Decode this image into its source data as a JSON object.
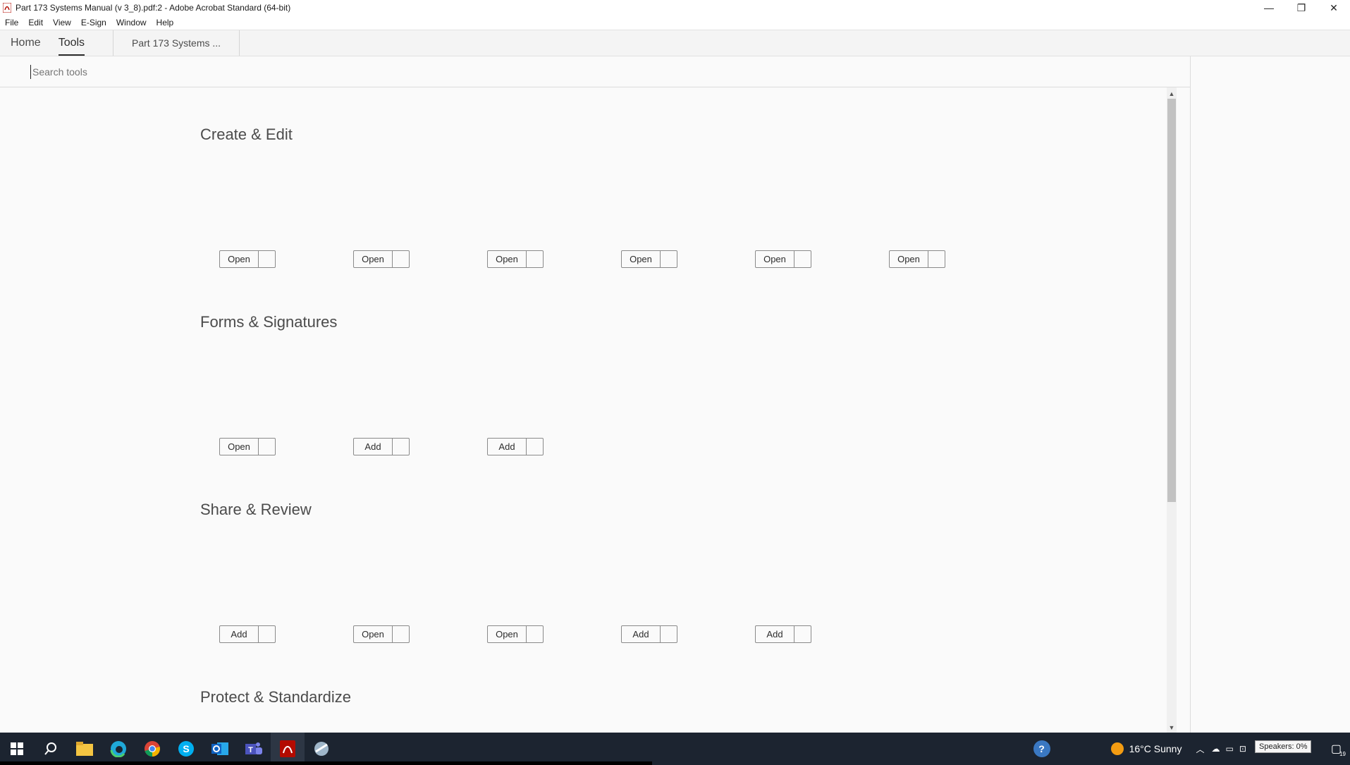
{
  "window": {
    "title": "Part 173 Systems Manual (v 3_8).pdf:2 - Adobe Acrobat Standard (64-bit)",
    "controls": {
      "minimize": "—",
      "restore": "❐",
      "close": "✕"
    }
  },
  "menu": [
    "File",
    "Edit",
    "View",
    "E-Sign",
    "Window",
    "Help"
  ],
  "tabs": {
    "home": "Home",
    "tools": "Tools",
    "document": "Part 173 Systems ..."
  },
  "search": {
    "placeholder": "Search tools"
  },
  "sections": [
    {
      "title": "Create & Edit",
      "buttons": [
        "Open",
        "Open",
        "Open",
        "Open",
        "Open",
        "Open"
      ]
    },
    {
      "title": "Forms & Signatures",
      "buttons": [
        "Open",
        "Add",
        "Add"
      ]
    },
    {
      "title": "Share & Review",
      "buttons": [
        "Add",
        "Open",
        "Open",
        "Add",
        "Add"
      ]
    },
    {
      "title": "Protect & Standardize",
      "buttons": []
    }
  ],
  "taskbar": {
    "icons": [
      "windows-start-icon",
      "search-icon",
      "file-explorer-icon",
      "edge-icon",
      "chrome-icon",
      "skype-icon",
      "outlook-icon",
      "teams-icon",
      "acrobat-icon",
      "app-icon"
    ],
    "weather": "16°C  Sunny",
    "tooltip": "Speakers: 0%",
    "notification_count": "19"
  },
  "colors": {
    "accent": "#2c2c2c",
    "taskbar": "#1c2430"
  }
}
